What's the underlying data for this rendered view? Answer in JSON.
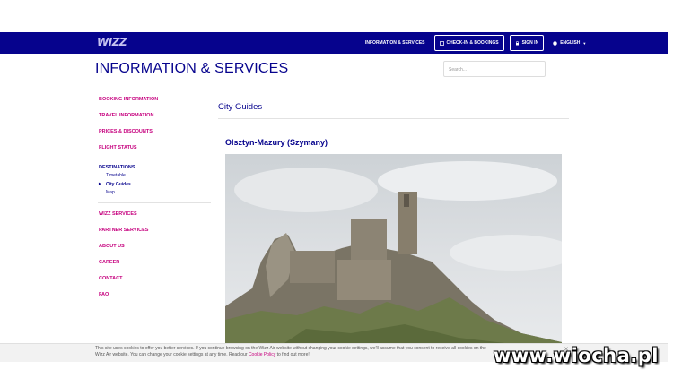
{
  "header": {
    "logo": "WIZZ",
    "nav_info": "INFORMATION & SERVICES",
    "nav_checkin": "CHECK-IN & BOOKINGS",
    "nav_signin": "SIGN IN",
    "nav_lang": "ENGLISH"
  },
  "page": {
    "title": "INFORMATION & SERVICES",
    "search_placeholder": "Search..."
  },
  "sidebar": {
    "top_items": [
      {
        "label": "BOOKING INFORMATION"
      },
      {
        "label": "TRAVEL INFORMATION"
      },
      {
        "label": "PRICES & DISCOUNTS"
      },
      {
        "label": "FLIGHT STATUS"
      }
    ],
    "destinations": {
      "label": "DESTINATIONS",
      "sub": [
        {
          "label": "Timetable"
        },
        {
          "label": "City Guides"
        },
        {
          "label": "Map"
        }
      ]
    },
    "bottom_items": [
      {
        "label": "WIZZ SERVICES"
      },
      {
        "label": "PARTNER SERVICES"
      },
      {
        "label": "ABOUT US"
      },
      {
        "label": "CAREER"
      },
      {
        "label": "CONTACT"
      },
      {
        "label": "FAQ"
      }
    ]
  },
  "main": {
    "section_title": "City Guides",
    "city_title": "Olsztyn-Mazury (Szymany)"
  },
  "cookie": {
    "text_1": "This site uses cookies to offer you better services. If you continue browsing on the Wizz Air website without changing your cookie settings, we'll assume that you consent to receive all cookies on the",
    "text_2": "Wizz Air website. You can change your cookie settings at any time. Read our",
    "link": "Cookie Policy",
    "text_3": "to find out more!"
  },
  "watermark": "www.wiocha.pl",
  "colors": {
    "brand_blue": "#06038d",
    "brand_magenta": "#c6007e"
  }
}
